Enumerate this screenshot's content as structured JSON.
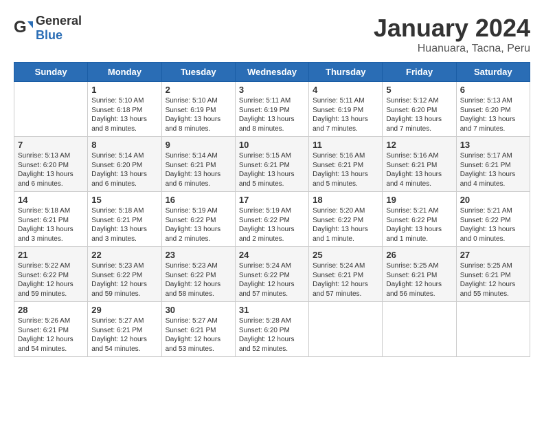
{
  "header": {
    "logo_general": "General",
    "logo_blue": "Blue",
    "title": "January 2024",
    "subtitle": "Huanuara, Tacna, Peru"
  },
  "calendar": {
    "days": [
      "Sunday",
      "Monday",
      "Tuesday",
      "Wednesday",
      "Thursday",
      "Friday",
      "Saturday"
    ],
    "weeks": [
      [
        {
          "date": "",
          "content": ""
        },
        {
          "date": "1",
          "content": "Sunrise: 5:10 AM\nSunset: 6:18 PM\nDaylight: 13 hours\nand 8 minutes."
        },
        {
          "date": "2",
          "content": "Sunrise: 5:10 AM\nSunset: 6:19 PM\nDaylight: 13 hours\nand 8 minutes."
        },
        {
          "date": "3",
          "content": "Sunrise: 5:11 AM\nSunset: 6:19 PM\nDaylight: 13 hours\nand 8 minutes."
        },
        {
          "date": "4",
          "content": "Sunrise: 5:11 AM\nSunset: 6:19 PM\nDaylight: 13 hours\nand 7 minutes."
        },
        {
          "date": "5",
          "content": "Sunrise: 5:12 AM\nSunset: 6:20 PM\nDaylight: 13 hours\nand 7 minutes."
        },
        {
          "date": "6",
          "content": "Sunrise: 5:13 AM\nSunset: 6:20 PM\nDaylight: 13 hours\nand 7 minutes."
        }
      ],
      [
        {
          "date": "7",
          "content": "Sunrise: 5:13 AM\nSunset: 6:20 PM\nDaylight: 13 hours\nand 6 minutes."
        },
        {
          "date": "8",
          "content": "Sunrise: 5:14 AM\nSunset: 6:20 PM\nDaylight: 13 hours\nand 6 minutes."
        },
        {
          "date": "9",
          "content": "Sunrise: 5:14 AM\nSunset: 6:21 PM\nDaylight: 13 hours\nand 6 minutes."
        },
        {
          "date": "10",
          "content": "Sunrise: 5:15 AM\nSunset: 6:21 PM\nDaylight: 13 hours\nand 5 minutes."
        },
        {
          "date": "11",
          "content": "Sunrise: 5:16 AM\nSunset: 6:21 PM\nDaylight: 13 hours\nand 5 minutes."
        },
        {
          "date": "12",
          "content": "Sunrise: 5:16 AM\nSunset: 6:21 PM\nDaylight: 13 hours\nand 4 minutes."
        },
        {
          "date": "13",
          "content": "Sunrise: 5:17 AM\nSunset: 6:21 PM\nDaylight: 13 hours\nand 4 minutes."
        }
      ],
      [
        {
          "date": "14",
          "content": "Sunrise: 5:18 AM\nSunset: 6:21 PM\nDaylight: 13 hours\nand 3 minutes."
        },
        {
          "date": "15",
          "content": "Sunrise: 5:18 AM\nSunset: 6:21 PM\nDaylight: 13 hours\nand 3 minutes."
        },
        {
          "date": "16",
          "content": "Sunrise: 5:19 AM\nSunset: 6:22 PM\nDaylight: 13 hours\nand 2 minutes."
        },
        {
          "date": "17",
          "content": "Sunrise: 5:19 AM\nSunset: 6:22 PM\nDaylight: 13 hours\nand 2 minutes."
        },
        {
          "date": "18",
          "content": "Sunrise: 5:20 AM\nSunset: 6:22 PM\nDaylight: 13 hours\nand 1 minute."
        },
        {
          "date": "19",
          "content": "Sunrise: 5:21 AM\nSunset: 6:22 PM\nDaylight: 13 hours\nand 1 minute."
        },
        {
          "date": "20",
          "content": "Sunrise: 5:21 AM\nSunset: 6:22 PM\nDaylight: 13 hours\nand 0 minutes."
        }
      ],
      [
        {
          "date": "21",
          "content": "Sunrise: 5:22 AM\nSunset: 6:22 PM\nDaylight: 12 hours\nand 59 minutes."
        },
        {
          "date": "22",
          "content": "Sunrise: 5:23 AM\nSunset: 6:22 PM\nDaylight: 12 hours\nand 59 minutes."
        },
        {
          "date": "23",
          "content": "Sunrise: 5:23 AM\nSunset: 6:22 PM\nDaylight: 12 hours\nand 58 minutes."
        },
        {
          "date": "24",
          "content": "Sunrise: 5:24 AM\nSunset: 6:22 PM\nDaylight: 12 hours\nand 57 minutes."
        },
        {
          "date": "25",
          "content": "Sunrise: 5:24 AM\nSunset: 6:21 PM\nDaylight: 12 hours\nand 57 minutes."
        },
        {
          "date": "26",
          "content": "Sunrise: 5:25 AM\nSunset: 6:21 PM\nDaylight: 12 hours\nand 56 minutes."
        },
        {
          "date": "27",
          "content": "Sunrise: 5:25 AM\nSunset: 6:21 PM\nDaylight: 12 hours\nand 55 minutes."
        }
      ],
      [
        {
          "date": "28",
          "content": "Sunrise: 5:26 AM\nSunset: 6:21 PM\nDaylight: 12 hours\nand 54 minutes."
        },
        {
          "date": "29",
          "content": "Sunrise: 5:27 AM\nSunset: 6:21 PM\nDaylight: 12 hours\nand 54 minutes."
        },
        {
          "date": "30",
          "content": "Sunrise: 5:27 AM\nSunset: 6:21 PM\nDaylight: 12 hours\nand 53 minutes."
        },
        {
          "date": "31",
          "content": "Sunrise: 5:28 AM\nSunset: 6:20 PM\nDaylight: 12 hours\nand 52 minutes."
        },
        {
          "date": "",
          "content": ""
        },
        {
          "date": "",
          "content": ""
        },
        {
          "date": "",
          "content": ""
        }
      ]
    ]
  }
}
